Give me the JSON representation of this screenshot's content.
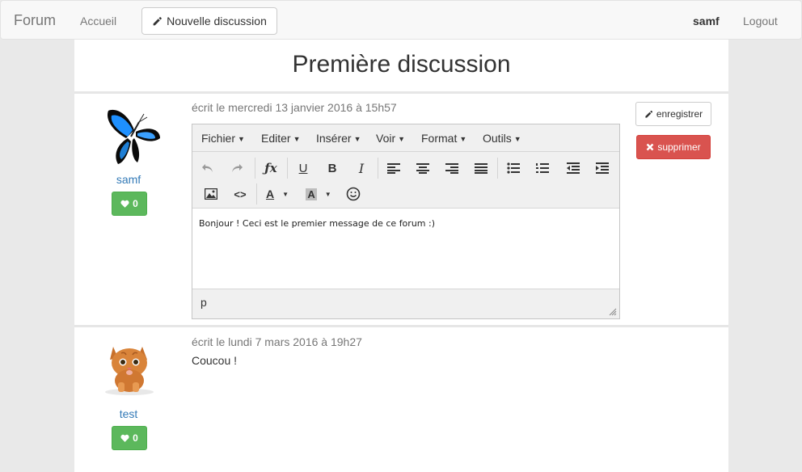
{
  "navbar": {
    "brand": "Forum",
    "home": "Accueil",
    "new_discussion": "Nouvelle discussion",
    "user": "samf",
    "logout": "Logout"
  },
  "page": {
    "title": "Première discussion"
  },
  "posts": [
    {
      "author": "samf",
      "likes": "0",
      "meta": "écrit le mercredi 13 janvier 2016 à 15h57",
      "editor": {
        "menus": [
          "Fichier",
          "Editer",
          "Insérer",
          "Voir",
          "Format",
          "Outils"
        ],
        "content": "Bonjour ! Ceci est le premier message de ce forum :)",
        "status_path": "p"
      },
      "save_label": "enregistrer",
      "delete_label": "supprimer"
    },
    {
      "author": "test",
      "likes": "0",
      "meta": "écrit le lundi 7 mars 2016 à 19h27",
      "text": "Coucou !"
    }
  ],
  "colors": {
    "success": "#5cb85c",
    "danger": "#d9534f",
    "link": "#337ab7"
  }
}
